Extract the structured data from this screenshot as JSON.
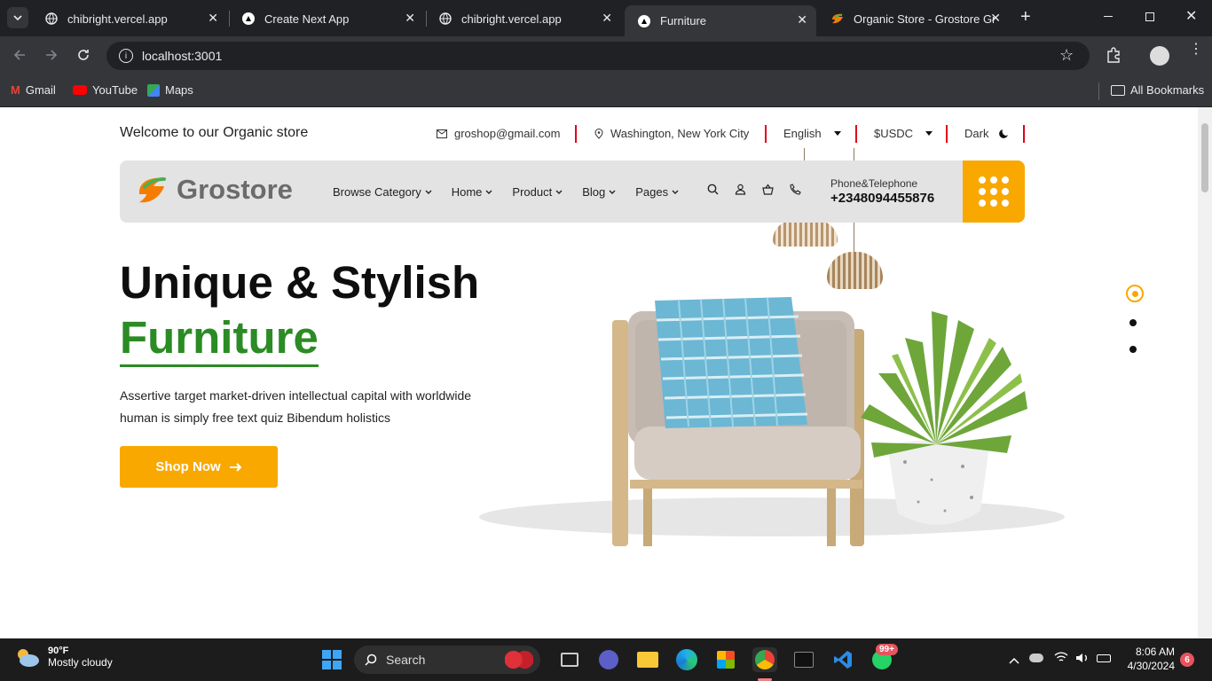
{
  "tabs": [
    {
      "title": "chibright.vercel.app",
      "icon": "globe-icon"
    },
    {
      "title": "Create Next App",
      "icon": "nextjs-icon"
    },
    {
      "title": "chibright.vercel.app",
      "icon": "globe-icon"
    },
    {
      "title": "Furniture",
      "icon": "nextjs-icon"
    },
    {
      "title": "Organic Store - Grostore Gro",
      "icon": "grostore-icon"
    }
  ],
  "address": "localhost:3001",
  "bookmarks": [
    {
      "label": "Gmail"
    },
    {
      "label": "YouTube"
    },
    {
      "label": "Maps"
    }
  ],
  "all_bookmarks": "All Bookmarks",
  "site": {
    "welcome": "Welcome to our Organic store",
    "email": "groshop@gmail.com",
    "location": "Washington, New York City",
    "language": "English",
    "currency": "$USDC",
    "theme": "Dark",
    "logo": "Grostore",
    "menu": [
      "Browse Category",
      "Home",
      "Product",
      "Blog",
      "Pages"
    ],
    "phone_label": "Phone&Telephone",
    "phone_number": "+2348094455876",
    "hero_line1": "Unique & Stylish",
    "hero_line2": "Furniture",
    "hero_desc": "Assertive target market-driven intellectual capital with worldwide human is simply free text quiz Bibendum holistics",
    "cta": "Shop Now",
    "colors": {
      "accent": "#f9a800",
      "green": "#2b8b24"
    }
  },
  "taskbar": {
    "temp": "90°F",
    "weather": "Mostly cloudy",
    "search": "Search",
    "whatsapp_badge": "99+",
    "time": "8:06 AM",
    "date": "4/30/2024",
    "notif_count": "6"
  }
}
